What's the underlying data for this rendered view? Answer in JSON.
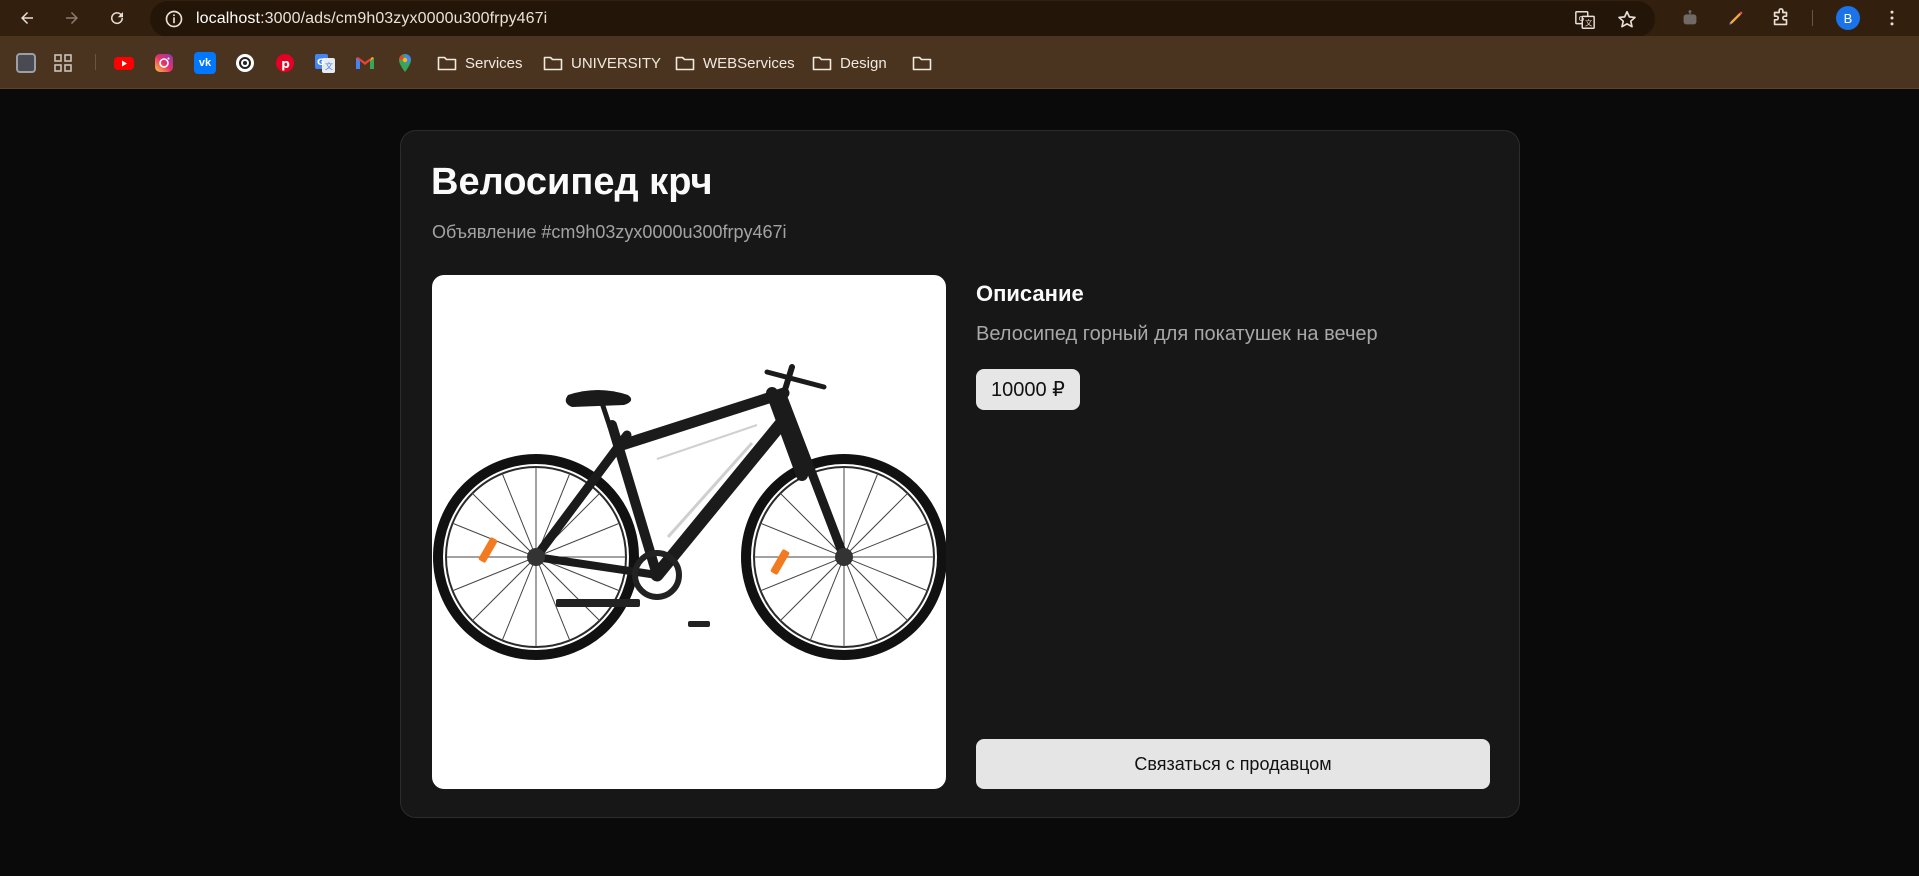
{
  "browser": {
    "url_host": "localhost",
    "url_path": ":3000/ads/cm9h03zyx0000u300frpy467i",
    "avatar_letter": "B",
    "bookmarks": [
      {
        "icon": "app-icon",
        "label": ""
      },
      {
        "icon": "grid-icon",
        "label": ""
      },
      {
        "icon": "youtube-icon",
        "label": ""
      },
      {
        "icon": "instagram-icon",
        "label": ""
      },
      {
        "icon": "vk-icon",
        "label": ""
      },
      {
        "icon": "openai-icon",
        "label": ""
      },
      {
        "icon": "pinterest-icon",
        "label": ""
      },
      {
        "icon": "google-translate-icon",
        "label": ""
      },
      {
        "icon": "gmail-icon",
        "label": ""
      },
      {
        "icon": "google-maps-icon",
        "label": ""
      }
    ],
    "folders": [
      "Services",
      "UNIVERSITY",
      "WEBServices",
      "Design",
      ""
    ]
  },
  "ad": {
    "title": "Велосипед крч",
    "subtitle": "Объявление #cm9h03zyx0000u300frpy467i",
    "description_heading": "Описание",
    "description": "Велосипед горный для покатушек на вечер",
    "price": "10000 ₽",
    "contact_label": "Связаться с продавцом"
  },
  "colors": {
    "page_bg": "#0a0a0a",
    "card_bg": "#171717",
    "chrome_top": "#331f0e",
    "bookmarks_bar": "#4a3420",
    "button_bg": "#e5e5e5"
  }
}
